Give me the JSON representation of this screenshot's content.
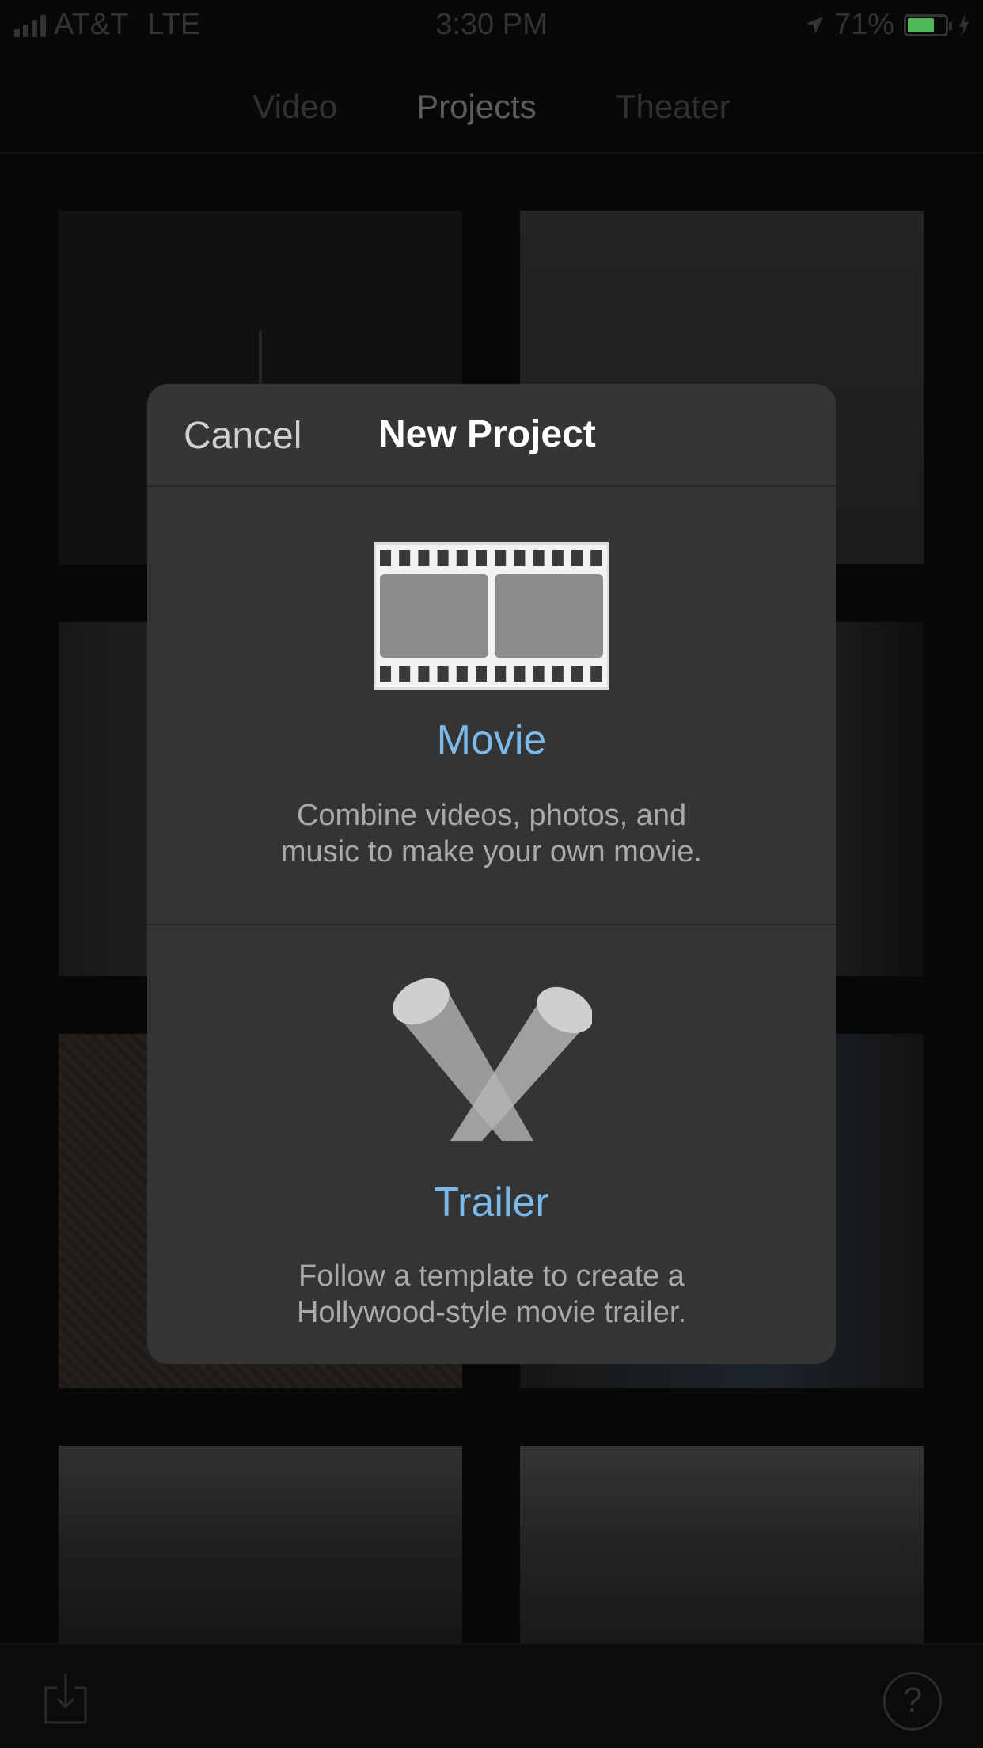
{
  "status_bar": {
    "carrier": "AT&T",
    "network": "LTE",
    "time": "3:30 PM",
    "battery_percent": "71%",
    "battery_level": 0.71
  },
  "tabs": [
    {
      "label": "Video",
      "active": false
    },
    {
      "label": "Projects",
      "active": true
    },
    {
      "label": "Theater",
      "active": false
    }
  ],
  "modal": {
    "cancel_label": "Cancel",
    "title": "New Project",
    "options": [
      {
        "icon": "film-strip-icon",
        "label": "Movie",
        "description_line1": "Combine videos, photos, and",
        "description_line2": "music to make your own movie."
      },
      {
        "icon": "spotlights-icon",
        "label": "Trailer",
        "description_line1": "Follow a template to create a",
        "description_line2": "Hollywood-style movie trailer."
      }
    ]
  },
  "bottom_bar": {
    "import_icon": "import-tray-icon",
    "help_label": "?"
  },
  "colors": {
    "accent": "#7ab9ea",
    "modal_bg": "#343434",
    "battery_fill": "#5fd86a"
  }
}
